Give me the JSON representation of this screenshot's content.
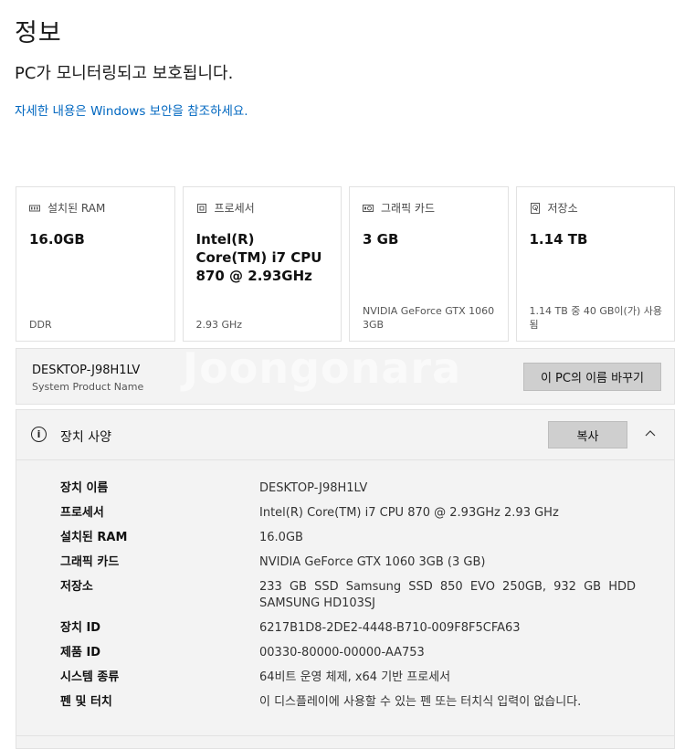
{
  "header": {
    "title": "정보",
    "status": "PC가 모니터링되고 보호됩니다.",
    "link": "자세한 내용은 Windows 보안을 참조하세요."
  },
  "cards": [
    {
      "icon": "ram-icon",
      "label": "설치된 RAM",
      "value": "16.0GB",
      "sub": "DDR"
    },
    {
      "icon": "processor-icon",
      "label": "프로세서",
      "value": "Intel(R) Core(TM) i7 CPU 870 @ 2.93GHz",
      "sub": "2.93 GHz"
    },
    {
      "icon": "graphics-card-icon",
      "label": "그래픽 카드",
      "value": "3 GB",
      "sub": "NVIDIA GeForce GTX 1060 3GB"
    },
    {
      "icon": "storage-icon",
      "label": "저장소",
      "value": "1.14 TB",
      "sub": "1.14 TB 중 40 GB이(가) 사용됨"
    }
  ],
  "device": {
    "name": "DESKTOP-J98H1LV",
    "caption": "System Product Name",
    "rename_label": "이 PC의 이름 바꾸기"
  },
  "specs": {
    "title": "장치 사양",
    "copy_label": "복사",
    "rows": [
      {
        "key": "장치 이름",
        "value": "DESKTOP-J98H1LV"
      },
      {
        "key": "프로세서",
        "value": "Intel(R) Core(TM) i7 CPU 870 @ 2.93GHz 2.93 GHz"
      },
      {
        "key": "설치된 RAM",
        "value": "16.0GB"
      },
      {
        "key": "그래픽 카드",
        "value": "NVIDIA GeForce GTX 1060 3GB (3 GB)"
      },
      {
        "key": "저장소",
        "value": "233 GB SSD Samsung SSD 850 EVO 250GB, 932 GB HDD SAMSUNG HD103SJ"
      },
      {
        "key": "장치 ID",
        "value": "6217B1D8-2DE2-4448-B710-009F8F5CFA63"
      },
      {
        "key": "제품 ID",
        "value": "00330-80000-00000-AA753"
      },
      {
        "key": "시스템 종류",
        "value": "64비트 운영 체제, x64 기반 프로세서"
      },
      {
        "key": "펜 및 터치",
        "value": "이 디스플레이에 사용할 수 있는 펜 또는 터치식 입력이 없습니다."
      }
    ]
  },
  "watermark": "Joongonara",
  "colors": {
    "link": "#0067c0",
    "panel": "#f3f3f3",
    "button": "#cfcfcf"
  }
}
